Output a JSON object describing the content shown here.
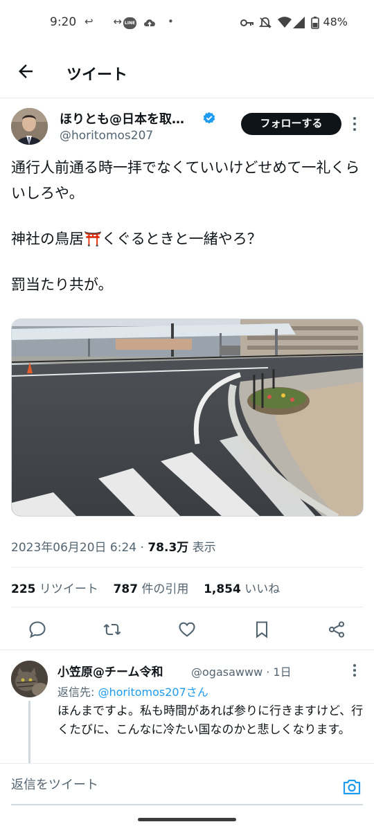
{
  "status_bar": {
    "time": "9:20",
    "line_badge": "LINE",
    "battery": "48%"
  },
  "header": {
    "title": "ツイート"
  },
  "tweet": {
    "author_name": "ほりとも@日本を取…",
    "author_handle": "@horitomos207",
    "follow_label": "フォローする",
    "text": [
      "通行人前通る時一拝でなくていいけどせめて一礼くらいしろや。",
      "神社の鳥居⛩️くぐるときと一緒やろ？",
      "罰当たり共が。"
    ],
    "timestamp": "2023年06月20日 6:24",
    "separator": "·",
    "views_count": "78.3万",
    "views_label": "表示",
    "retweets_count": "225",
    "retweets_label": "リツイート",
    "quotes_count": "787",
    "quotes_label": "件の引用",
    "likes_count": "1,854",
    "likes_label": "いいね"
  },
  "reply": {
    "author_name": "小笠原@チーム令和",
    "author_handle": "@ogasawww",
    "time": "· 1日",
    "reply_to_label": "返信先:",
    "reply_to_handle": "@horitomos207さん",
    "text": "ほんまですよ。私も時間があれば参りに行きますけど、行くたびに、こんなに冷たい国なのかと悲しくなります。"
  },
  "compose": {
    "placeholder": "返信をツイート"
  },
  "colors": {
    "accent": "#1d9bf0",
    "text": "#0f1419",
    "secondary": "#536471"
  }
}
